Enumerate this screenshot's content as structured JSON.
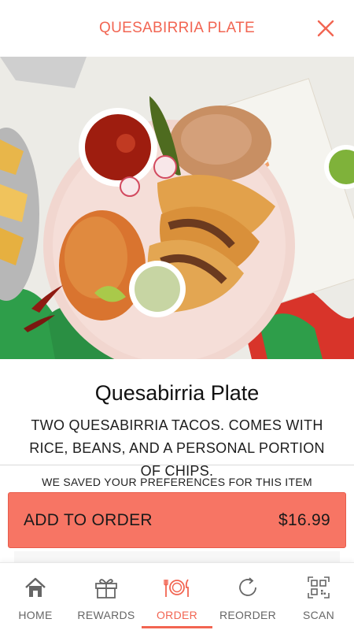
{
  "header": {
    "title": "QUESABIRRIA PLATE",
    "close_icon": "close-icon"
  },
  "hero": {
    "alt": "quesabirria-plate-photo"
  },
  "product": {
    "name": "Quesabirria Plate",
    "description": "TWO QUESABIRRIA TACOS. COMES WITH RICE, BEANS, AND A PERSONAL PORTION OF CHIPS."
  },
  "preferences_note": "WE SAVED YOUR PREFERENCES FOR THIS ITEM",
  "add_to_order": {
    "label": "ADD TO ORDER",
    "price": "$16.99"
  },
  "nav": {
    "items": [
      {
        "label": "HOME",
        "icon": "home-icon"
      },
      {
        "label": "REWARDS",
        "icon": "gift-icon"
      },
      {
        "label": "ORDER",
        "icon": "plate-utensils-icon"
      },
      {
        "label": "REORDER",
        "icon": "reorder-icon"
      },
      {
        "label": "SCAN",
        "icon": "qr-code-icon"
      }
    ],
    "active": "ORDER"
  },
  "colors": {
    "accent": "#f26552",
    "button": "#f77564"
  }
}
